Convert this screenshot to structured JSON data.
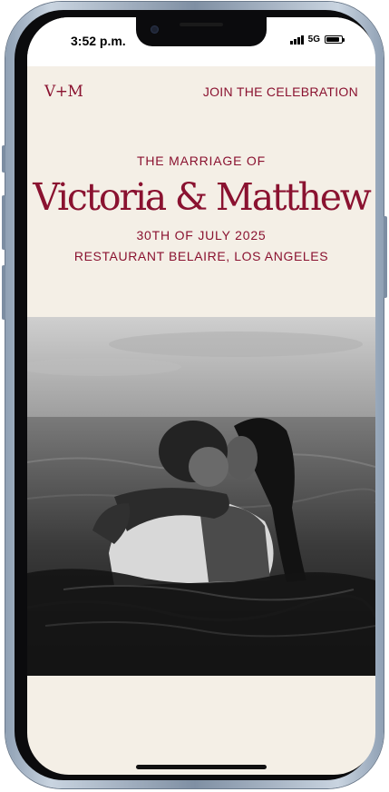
{
  "status_bar": {
    "time": "3:52 p.m.",
    "network": "5G",
    "battery_level": 0.9
  },
  "header": {
    "monogram": "V+M",
    "cta_label": "JOIN THE CELEBRATION"
  },
  "hero": {
    "eyebrow": "THE MARRIAGE OF",
    "names": "Victoria & Matthew",
    "date": "30TH OF JULY 2025",
    "venue": "RESTAURANT BELAIRE, LOS ANGELES"
  },
  "theme": {
    "accent": "#8a1230",
    "background": "#f4efe6"
  },
  "icons": [
    "signal-icon",
    "battery-icon"
  ]
}
